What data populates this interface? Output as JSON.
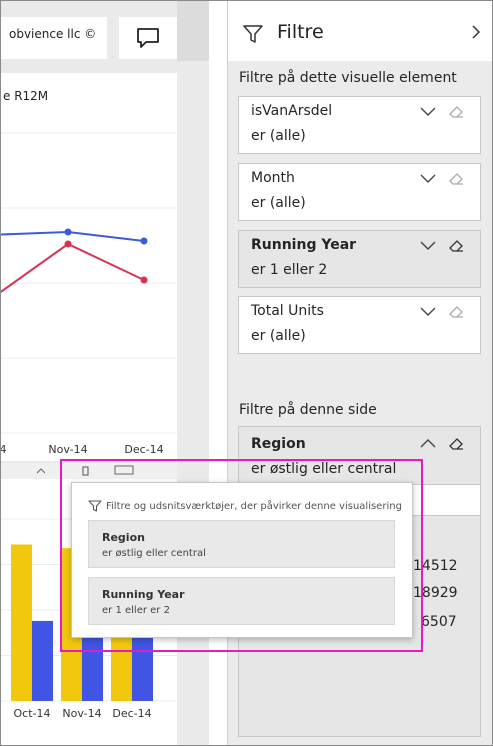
{
  "report": {
    "brand_label": "obvience llc ©",
    "line_visual_title": "e R12M",
    "chat_icon": "comment-icon"
  },
  "colors": {
    "blue_series": "#3b5bdb",
    "red_series": "#d9314f",
    "yellow_bar": "#f2c80f",
    "blue_bar": "#4055e4",
    "highlight_border": "#e619c8"
  },
  "chart_data": [
    {
      "type": "line",
      "categories": [
        "Oct-14",
        "Nov-14",
        "Dec-14"
      ],
      "series": [
        {
          "values": [
            66,
            67,
            64
          ]
        },
        {
          "values": [
            44,
            63,
            51
          ]
        }
      ],
      "ylim": [
        0,
        100
      ],
      "grid": true
    },
    {
      "type": "bar",
      "categories": [
        "Oct-14",
        "Nov-14",
        "Dec-14"
      ],
      "series": [
        {
          "values": [
            86,
            84,
            80
          ]
        },
        {
          "values": [
            44,
            70,
            46
          ]
        }
      ],
      "ylim": [
        0,
        100
      ],
      "grid": true
    }
  ],
  "filter_pane": {
    "title": "Filtre",
    "visual_section_label": "Filtre på dette visuelle element",
    "page_section_label": "Filtre på denne side",
    "visual_filters": [
      {
        "name": "isVanArsdel",
        "value": "er (alle)"
      },
      {
        "name": "Month",
        "value": "er (alle)"
      },
      {
        "name": "Running Year",
        "value": "er 1 eller 2"
      },
      {
        "name": "Total Units",
        "value": "er (alle)"
      }
    ],
    "page_filters": [
      {
        "name": "Region",
        "value": "er østlig eller central",
        "numbers": [
          "14512",
          "18929",
          "6507"
        ]
      }
    ]
  },
  "tooltip": {
    "header": "Filtre og udsnitsværktøjer, der påvirker denne visualisering",
    "items": [
      {
        "name": "Region",
        "value": "er østlig eller central"
      },
      {
        "name": "Running Year",
        "value": "er 1 eller er 2"
      }
    ]
  }
}
